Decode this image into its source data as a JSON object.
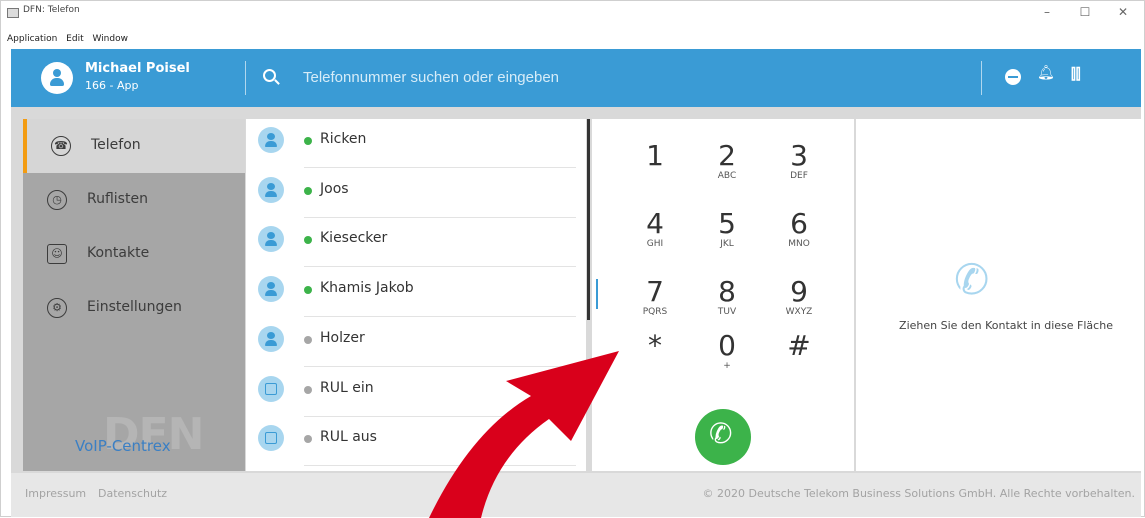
{
  "window": {
    "title": "DFN: Telefon",
    "controls": [
      "–",
      "☐",
      "✕"
    ]
  },
  "menu": [
    "Application",
    "Edit",
    "Window"
  ],
  "user": {
    "name": "Michael Poisel",
    "extension": "166 - App"
  },
  "search": {
    "placeholder": "Telefonnummer suchen oder eingeben"
  },
  "sidebar": {
    "items": [
      {
        "label": "Telefon",
        "icon": "phone-icon",
        "active": true
      },
      {
        "label": "Ruflisten",
        "icon": "clock-icon",
        "active": false
      },
      {
        "label": "Kontakte",
        "icon": "contact-card-icon",
        "active": false
      },
      {
        "label": "Einstellungen",
        "icon": "gear-icon",
        "active": false
      }
    ],
    "logo_main": "DFN",
    "logo_sub": "VoIP-Centrex"
  },
  "contacts": [
    {
      "name": "Ricken",
      "status": "online",
      "status_color": "#3cb34a",
      "type": "person"
    },
    {
      "name": "Joos",
      "status": "online",
      "status_color": "#3cb34a",
      "type": "person"
    },
    {
      "name": "Kiesecker",
      "status": "online",
      "status_color": "#3cb34a",
      "type": "person"
    },
    {
      "name": "Khamis Jakob",
      "status": "online",
      "status_color": "#3cb34a",
      "type": "person"
    },
    {
      "name": "Holzer",
      "status": "offline",
      "status_color": "#a6a6a6",
      "type": "person"
    },
    {
      "name": "RUL ein",
      "status": "offline",
      "status_color": "#a6a6a6",
      "type": "function"
    },
    {
      "name": "RUL aus",
      "status": "offline",
      "status_color": "#a6a6a6",
      "type": "function"
    }
  ],
  "dialpad": {
    "keys": [
      {
        "digit": "1",
        "letters": ""
      },
      {
        "digit": "2",
        "letters": "ABC"
      },
      {
        "digit": "3",
        "letters": "DEF"
      },
      {
        "digit": "4",
        "letters": "GHI"
      },
      {
        "digit": "5",
        "letters": "JKL"
      },
      {
        "digit": "6",
        "letters": "MNO"
      },
      {
        "digit": "7",
        "letters": "PQRS"
      },
      {
        "digit": "8",
        "letters": "TUV"
      },
      {
        "digit": "9",
        "letters": "WXYZ"
      },
      {
        "digit": "*",
        "letters": ""
      },
      {
        "digit": "0",
        "letters": "+"
      },
      {
        "digit": "#",
        "letters": ""
      }
    ]
  },
  "dropzone": {
    "text": "Ziehen Sie den Kontakt in diese Fläche"
  },
  "footer": {
    "links": [
      "Impressum",
      "Datenschutz"
    ],
    "copyright": "© 2020 Deutsche Telekom Business Solutions GmbH. Alle Rechte vorbehalten."
  },
  "colors": {
    "accent": "#3a9bd5",
    "active_tab": "#f39c12",
    "call": "#3cb34a",
    "arrow": "#d9001b"
  }
}
